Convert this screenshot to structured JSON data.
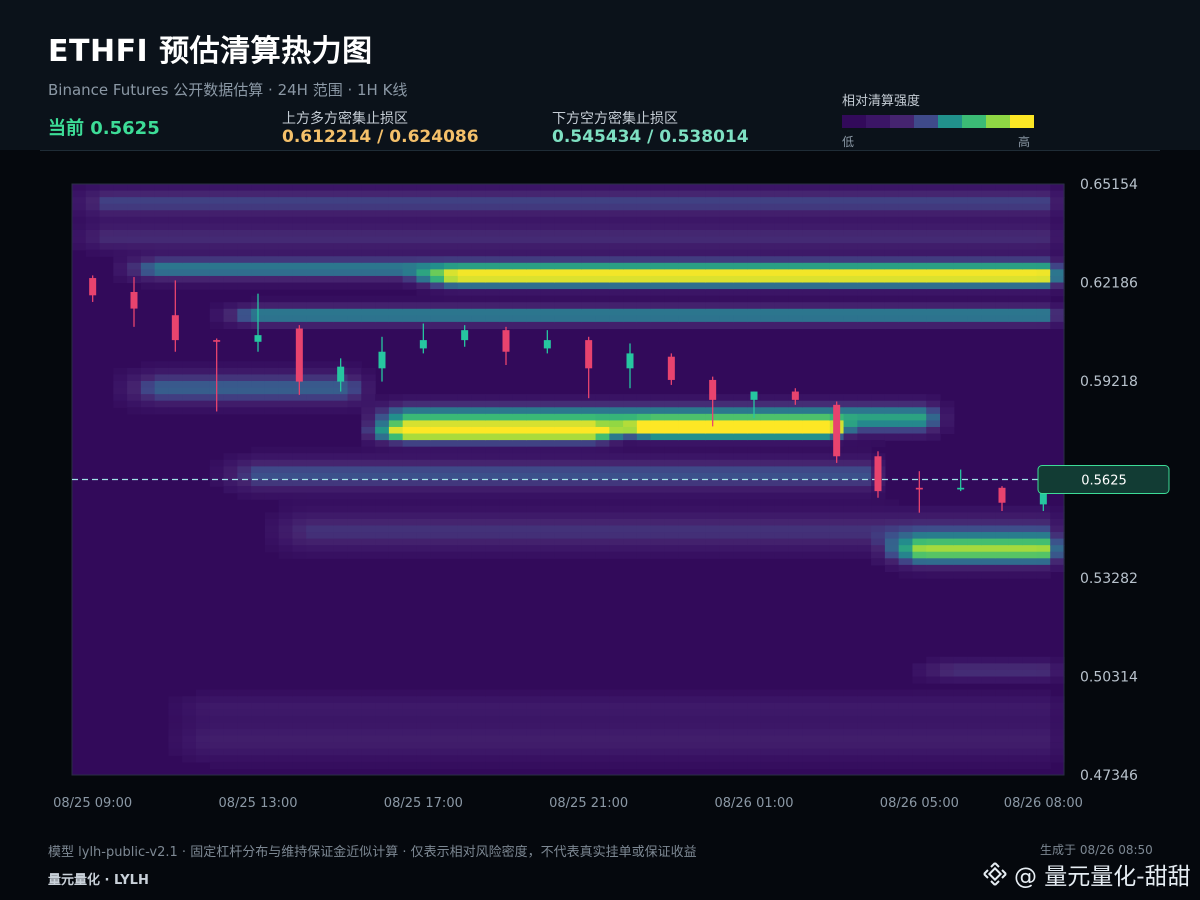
{
  "header": {
    "title": "ETHFI 预估清算热力图",
    "subtitle": "Binance Futures 公开数据估算  ·  24H 范围  ·  1H K线",
    "current_label": "当前 0.5625",
    "upper_zone_label": "上方多方密集止损区",
    "upper_zone_value": "0.612214 / 0.624086",
    "lower_zone_label": "下方空方密集止损区",
    "lower_zone_value": "0.545434 / 0.538014",
    "legend_title": "相对清算强度",
    "legend_low": "低",
    "legend_high": "高"
  },
  "colors": {
    "background": "#05080d",
    "header_bg": "#0b121a",
    "up_candle": "#26c6a0",
    "down_candle": "#e8436e",
    "current_green": "#3ddc97",
    "upper_value": "#f4c06a",
    "lower_value": "#7ee0c2",
    "current_line": "#9fe3e6",
    "colorscale": [
      "#320a5a",
      "#3b1566",
      "#45246f",
      "#3f4a8a",
      "#2f6f8e",
      "#21918c",
      "#3bbb75",
      "#8fd744",
      "#fde725"
    ]
  },
  "chart_data": {
    "type": "heatmap",
    "overlay": "candlestick",
    "y_ticks": [
      0.65154,
      0.62186,
      0.59218,
      0.5625,
      0.53282,
      0.50314,
      0.47346
    ],
    "y_tick_labels": [
      "0.65154",
      "0.62186",
      "0.59218",
      "0.5625",
      "0.53282",
      "0.50314",
      "0.47346"
    ],
    "ylim": [
      0.47346,
      0.65154
    ],
    "x_tick_labels": [
      "08/25 09:00",
      "08/25 13:00",
      "08/25 17:00",
      "08/25 21:00",
      "08/26 01:00",
      "08/26 05:00",
      "08/26 08:00"
    ],
    "current_price": 0.5625,
    "current_price_label": "0.5625",
    "heat_bands": [
      {
        "x_from": 0,
        "x_to": 1,
        "price": 0.646,
        "width": 0.0045,
        "intensity": 0.35
      },
      {
        "x_from": 0,
        "x_to": 1,
        "price": 0.6355,
        "width": 0.004,
        "intensity": 0.28
      },
      {
        "x_from": 0.05,
        "x_to": 1,
        "price": 0.626,
        "width": 0.0035,
        "intensity": 0.55
      },
      {
        "x_from": 0.35,
        "x_to": 1,
        "price": 0.623,
        "width": 0.003,
        "intensity": 0.72
      },
      {
        "x_from": 0.15,
        "x_to": 1,
        "price": 0.612,
        "width": 0.003,
        "intensity": 0.58
      },
      {
        "x_from": 0.3,
        "x_to": 0.88,
        "price": 0.581,
        "width": 0.0045,
        "intensity": 0.68
      },
      {
        "x_from": 0.55,
        "x_to": 0.78,
        "price": 0.5775,
        "width": 0.0025,
        "intensity": 1.0
      },
      {
        "x_from": 0.3,
        "x_to": 0.55,
        "price": 0.5765,
        "width": 0.003,
        "intensity": 0.88
      },
      {
        "x_from": 0.05,
        "x_to": 0.3,
        "price": 0.59,
        "width": 0.005,
        "intensity": 0.45
      },
      {
        "x_from": 0.15,
        "x_to": 0.82,
        "price": 0.564,
        "width": 0.005,
        "intensity": 0.4
      },
      {
        "x_from": 0.82,
        "x_to": 1,
        "price": 0.541,
        "width": 0.0045,
        "intensity": 0.78
      },
      {
        "x_from": 0.2,
        "x_to": 1,
        "price": 0.547,
        "width": 0.006,
        "intensity": 0.3
      },
      {
        "x_from": 0.85,
        "x_to": 1,
        "price": 0.505,
        "width": 0.003,
        "intensity": 0.3
      },
      {
        "x_from": 0.1,
        "x_to": 1,
        "price": 0.484,
        "width": 0.006,
        "intensity": 0.2
      },
      {
        "x_from": 0.1,
        "x_to": 1,
        "price": 0.494,
        "width": 0.004,
        "intensity": 0.15
      }
    ],
    "candles": [
      {
        "o": 0.6232,
        "h": 0.624,
        "l": 0.616,
        "c": 0.618
      },
      {
        "o": 0.619,
        "h": 0.6235,
        "l": 0.6085,
        "c": 0.614
      },
      {
        "o": 0.612,
        "h": 0.6225,
        "l": 0.601,
        "c": 0.6045
      },
      {
        "o": 0.6045,
        "h": 0.605,
        "l": 0.583,
        "c": 0.604
      },
      {
        "o": 0.604,
        "h": 0.6185,
        "l": 0.601,
        "c": 0.606
      },
      {
        "o": 0.608,
        "h": 0.609,
        "l": 0.588,
        "c": 0.592
      },
      {
        "o": 0.592,
        "h": 0.599,
        "l": 0.589,
        "c": 0.5965
      },
      {
        "o": 0.596,
        "h": 0.6055,
        "l": 0.592,
        "c": 0.601
      },
      {
        "o": 0.602,
        "h": 0.6095,
        "l": 0.6005,
        "c": 0.6045
      },
      {
        "o": 0.6045,
        "h": 0.609,
        "l": 0.6025,
        "c": 0.6075
      },
      {
        "o": 0.6075,
        "h": 0.6085,
        "l": 0.597,
        "c": 0.601
      },
      {
        "o": 0.602,
        "h": 0.6075,
        "l": 0.6005,
        "c": 0.6045
      },
      {
        "o": 0.6045,
        "h": 0.6055,
        "l": 0.587,
        "c": 0.596
      },
      {
        "o": 0.596,
        "h": 0.6035,
        "l": 0.59,
        "c": 0.6005
      },
      {
        "o": 0.5995,
        "h": 0.6005,
        "l": 0.591,
        "c": 0.5925
      },
      {
        "o": 0.5925,
        "h": 0.5935,
        "l": 0.5785,
        "c": 0.5865
      },
      {
        "o": 0.5865,
        "h": 0.589,
        "l": 0.581,
        "c": 0.589
      },
      {
        "o": 0.589,
        "h": 0.59,
        "l": 0.585,
        "c": 0.5865
      },
      {
        "o": 0.585,
        "h": 0.586,
        "l": 0.5675,
        "c": 0.5695
      },
      {
        "o": 0.5695,
        "h": 0.571,
        "l": 0.557,
        "c": 0.559
      },
      {
        "o": 0.56,
        "h": 0.565,
        "l": 0.5525,
        "c": 0.5595
      },
      {
        "o": 0.5595,
        "h": 0.5655,
        "l": 0.559,
        "c": 0.56
      },
      {
        "o": 0.56,
        "h": 0.5605,
        "l": 0.553,
        "c": 0.5555
      },
      {
        "o": 0.555,
        "h": 0.562,
        "l": 0.553,
        "c": 0.559
      }
    ]
  },
  "footer": {
    "note": "模型 lylh-public-v2.1  ·  固定杠杆分布与维持保证金近似计算  ·  仅表示相对风险密度，不代表真实挂单或保证收益",
    "brand": "量元量化  ·  LYLH",
    "generated": "生成于 08/26 08:50",
    "watermark": "@ 量元量化-甜甜"
  }
}
